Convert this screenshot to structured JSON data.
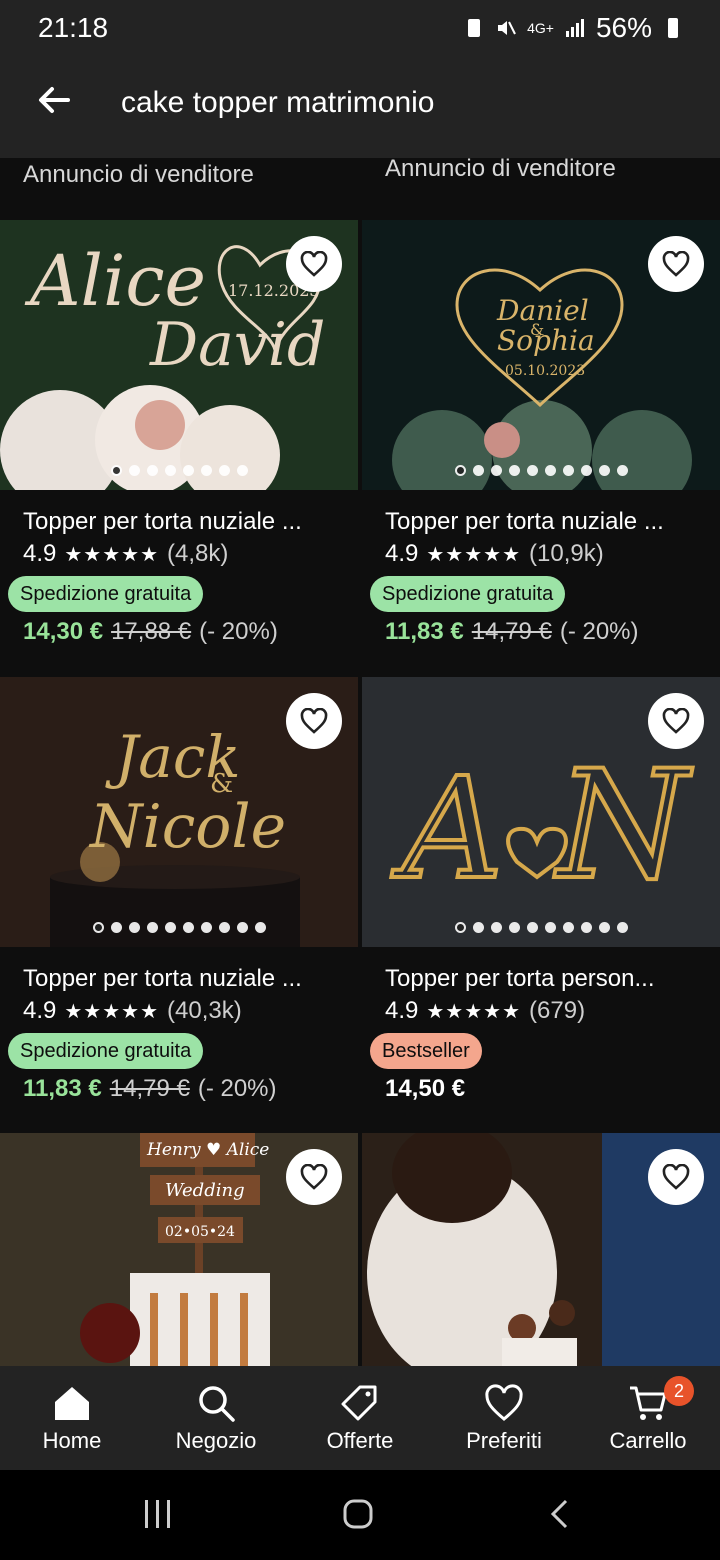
{
  "status": {
    "time": "21:18",
    "battery": "56%",
    "network": "4G+"
  },
  "search": {
    "query": "cake topper matrimonio"
  },
  "sponsored": [
    "Annuncio di venditore",
    "Annuncio di venditore"
  ],
  "products": [
    {
      "title": "Topper per torta nuziale ...",
      "rating": "4.9",
      "stars": "★★★★★",
      "reviews": "(4,8k)",
      "badge": "Spedizione gratuita",
      "price": "14,30 €",
      "old_price": "17,88 €",
      "discount": "(- 20%)",
      "image_text": [
        "Alice",
        "David",
        "17.12.2023"
      ]
    },
    {
      "title": "Topper per torta nuziale ...",
      "rating": "4.9",
      "stars": "★★★★★",
      "reviews": "(10,9k)",
      "badge": "Spedizione gratuita",
      "price": "11,83 €",
      "old_price": "14,79 €",
      "discount": "(- 20%)",
      "image_text": [
        "Daniel",
        "&",
        "Sophia",
        "05.10.2023"
      ]
    },
    {
      "title": "Topper per torta nuziale ...",
      "rating": "4.9",
      "stars": "★★★★★",
      "reviews": "(40,3k)",
      "badge": "Spedizione gratuita",
      "price": "11,83 €",
      "old_price": "14,79 €",
      "discount": "(- 20%)",
      "image_text": [
        "Jack",
        "&",
        "Nicole"
      ]
    },
    {
      "title": "Topper per torta person...",
      "rating": "4.9",
      "stars": "★★★★★",
      "reviews": "(679)",
      "badge": "Bestseller",
      "price": "14,50 €",
      "image_text": [
        "A",
        "N"
      ]
    },
    {
      "image_text": [
        "Henry ♥ Alice",
        "Wedding",
        "02•05•24"
      ]
    },
    {
      "image_text": []
    }
  ],
  "nav": [
    {
      "label": "Home",
      "icon": "home-icon"
    },
    {
      "label": "Negozio",
      "icon": "search-icon"
    },
    {
      "label": "Offerte",
      "icon": "tag-icon"
    },
    {
      "label": "Preferiti",
      "icon": "heart-icon"
    },
    {
      "label": "Carrello",
      "icon": "cart-icon",
      "badge": "2"
    }
  ]
}
